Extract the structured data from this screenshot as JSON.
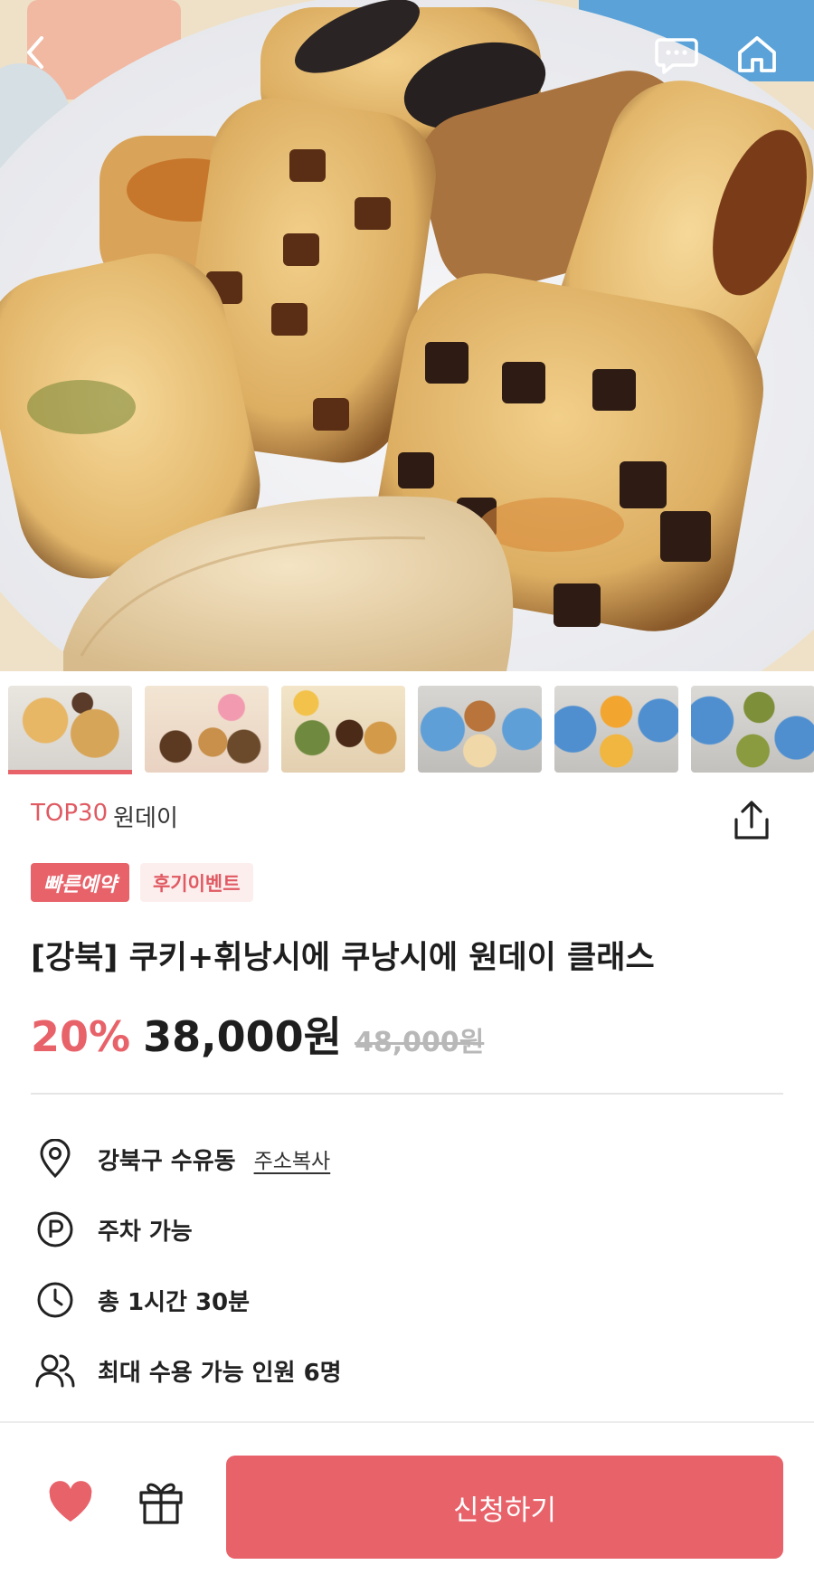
{
  "header": {
    "back_icon": "chevron-left-icon",
    "chat_icon": "chat-bubble-icon",
    "home_icon": "home-icon"
  },
  "gallery": {
    "thumbnails": [
      {
        "name": "thumbnail-1",
        "active": true
      },
      {
        "name": "thumbnail-2",
        "active": false
      },
      {
        "name": "thumbnail-3",
        "active": false
      },
      {
        "name": "thumbnail-4",
        "active": false
      },
      {
        "name": "thumbnail-5",
        "active": false
      },
      {
        "name": "thumbnail-6",
        "active": false
      }
    ],
    "active_index": 0
  },
  "product": {
    "rank_tag": "TOP30",
    "type_tag": "원데이",
    "badges": {
      "fast": "빠른예약",
      "review": "후기이벤트"
    },
    "title": "[강북] 쿠키+휘낭시에 쿠낭시에 원데이 클래스",
    "discount": "20%",
    "price": "38,000원",
    "original_price": "48,000원"
  },
  "details": {
    "location": "강북구 수유동",
    "copy_address": "주소복사",
    "parking": "주차 가능",
    "duration": "총 1시간 30분",
    "capacity": "최대 수용 가능 인원 6명"
  },
  "bottom_bar": {
    "apply_label": "신청하기"
  },
  "colors": {
    "accent": "#e8626a",
    "accent_light": "#fdeeee",
    "text": "#1e1e1e",
    "muted": "#b8b8b8"
  }
}
